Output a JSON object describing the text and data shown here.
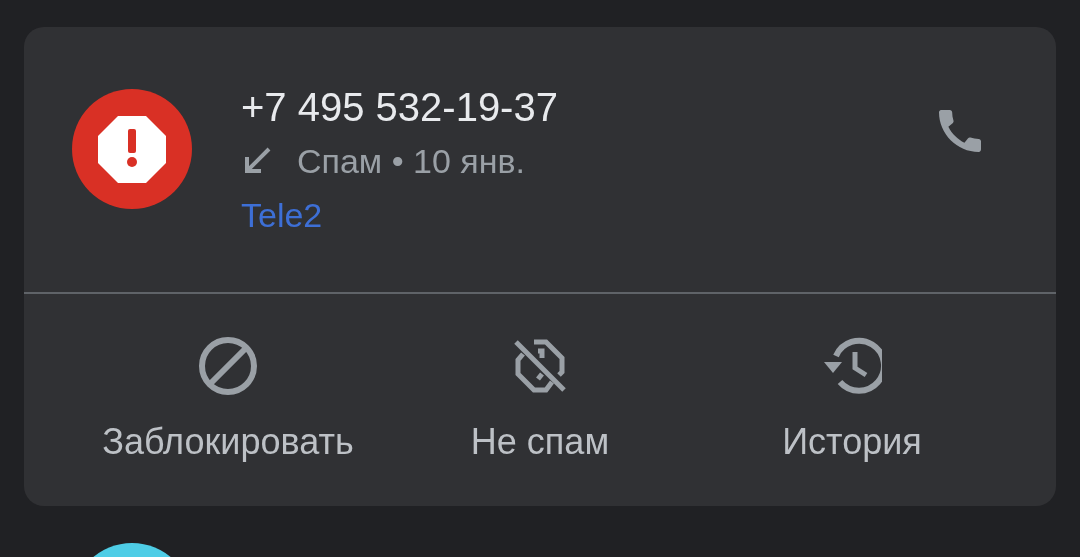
{
  "call": {
    "number": "+7 495 532-19-37",
    "details": "Спам • 10 янв.",
    "carrier": "Tele2"
  },
  "actions": [
    {
      "kind": "block",
      "label": "Заблокировать"
    },
    {
      "kind": "not_spam",
      "label": "Не спам"
    },
    {
      "kind": "history",
      "label": "История"
    }
  ]
}
